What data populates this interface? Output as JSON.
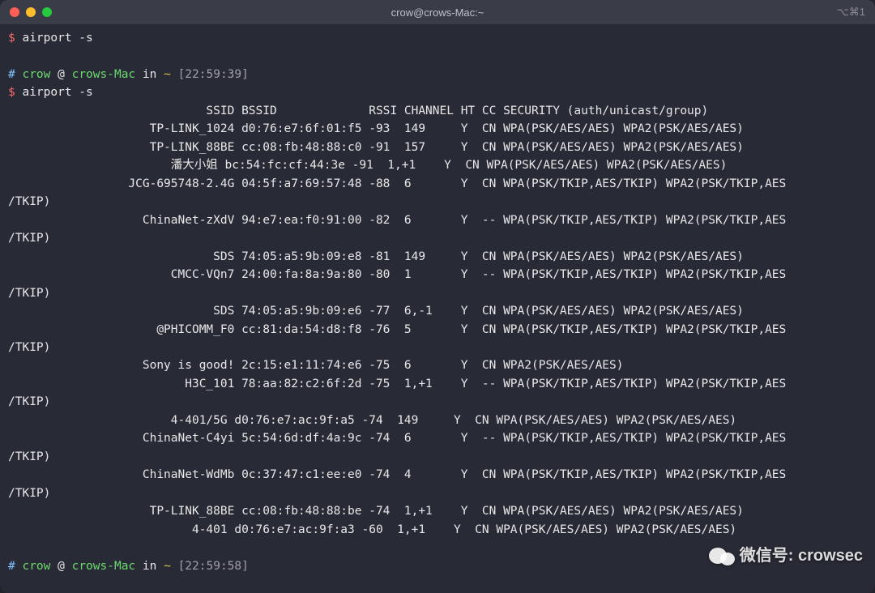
{
  "window": {
    "title": "crow@crows-Mac:~",
    "shortcut": "⌥⌘1"
  },
  "prompt1": {
    "symbol": "$",
    "command": "airport -s"
  },
  "prompt2": {
    "hash": "#",
    "user": "crow",
    "at": "@",
    "host": "crows-Mac",
    "in": "in",
    "path": "~",
    "time": "[22:59:39]"
  },
  "prompt3": {
    "symbol": "$",
    "command": "airport -s"
  },
  "header": "                            SSID BSSID             RSSI CHANNEL HT CC SECURITY (auth/unicast/group)",
  "rows": [
    "                    TP-LINK_1024 d0:76:e7:6f:01:f5 -93  149     Y  CN WPA(PSK/AES/AES) WPA2(PSK/AES/AES) ",
    "                    TP-LINK_88BE cc:08:fb:48:88:c0 -91  157     Y  CN WPA(PSK/AES/AES) WPA2(PSK/AES/AES) ",
    "                       潘大小姐 bc:54:fc:cf:44:3e -91  1,+1    Y  CN WPA(PSK/AES/AES) WPA2(PSK/AES/AES) ",
    "                 JCG-695748-2.4G 04:5f:a7:69:57:48 -88  6       Y  CN WPA(PSK/TKIP,AES/TKIP) WPA2(PSK/TKIP,AES",
    "/TKIP) ",
    "                   ChinaNet-zXdV 94:e7:ea:f0:91:00 -82  6       Y  -- WPA(PSK/TKIP,AES/TKIP) WPA2(PSK/TKIP,AES",
    "/TKIP) ",
    "                             SDS 74:05:a5:9b:09:e8 -81  149     Y  CN WPA(PSK/AES/AES) WPA2(PSK/AES/AES) ",
    "                       CMCC-VQn7 24:00:fa:8a:9a:80 -80  1       Y  -- WPA(PSK/TKIP,AES/TKIP) WPA2(PSK/TKIP,AES",
    "/TKIP) ",
    "                             SDS 74:05:a5:9b:09:e6 -77  6,-1    Y  CN WPA(PSK/AES/AES) WPA2(PSK/AES/AES) ",
    "                     @PHICOMM_F0 cc:81:da:54:d8:f8 -76  5       Y  CN WPA(PSK/TKIP,AES/TKIP) WPA2(PSK/TKIP,AES",
    "/TKIP) ",
    "                   Sony is good! 2c:15:e1:11:74:e6 -75  6       Y  CN WPA2(PSK/AES/AES) ",
    "                         H3C_101 78:aa:82:c2:6f:2d -75  1,+1    Y  -- WPA(PSK/TKIP,AES/TKIP) WPA2(PSK/TKIP,AES",
    "/TKIP) ",
    "                       4-401/5G d0:76:e7:ac:9f:a5 -74  149     Y  CN WPA(PSK/AES/AES) WPA2(PSK/AES/AES) ",
    "                   ChinaNet-C4yi 5c:54:6d:df:4a:9c -74  6       Y  -- WPA(PSK/TKIP,AES/TKIP) WPA2(PSK/TKIP,AES",
    "/TKIP) ",
    "                   ChinaNet-WdMb 0c:37:47:c1:ee:e0 -74  4       Y  CN WPA(PSK/TKIP,AES/TKIP) WPA2(PSK/TKIP,AES",
    "/TKIP) ",
    "                    TP-LINK_88BE cc:08:fb:48:88:be -74  1,+1    Y  CN WPA(PSK/AES/AES) WPA2(PSK/AES/AES) ",
    "                          4-401 d0:76:e7:ac:9f:a3 -60  1,+1    Y  CN WPA(PSK/AES/AES) WPA2(PSK/AES/AES) "
  ],
  "prompt4": {
    "hash": "#",
    "user": "crow",
    "at": "@",
    "host": "crows-Mac",
    "in": "in",
    "path": "~",
    "time": "[22:59:58]"
  },
  "watermark": {
    "text": "微信号: crowsec"
  }
}
